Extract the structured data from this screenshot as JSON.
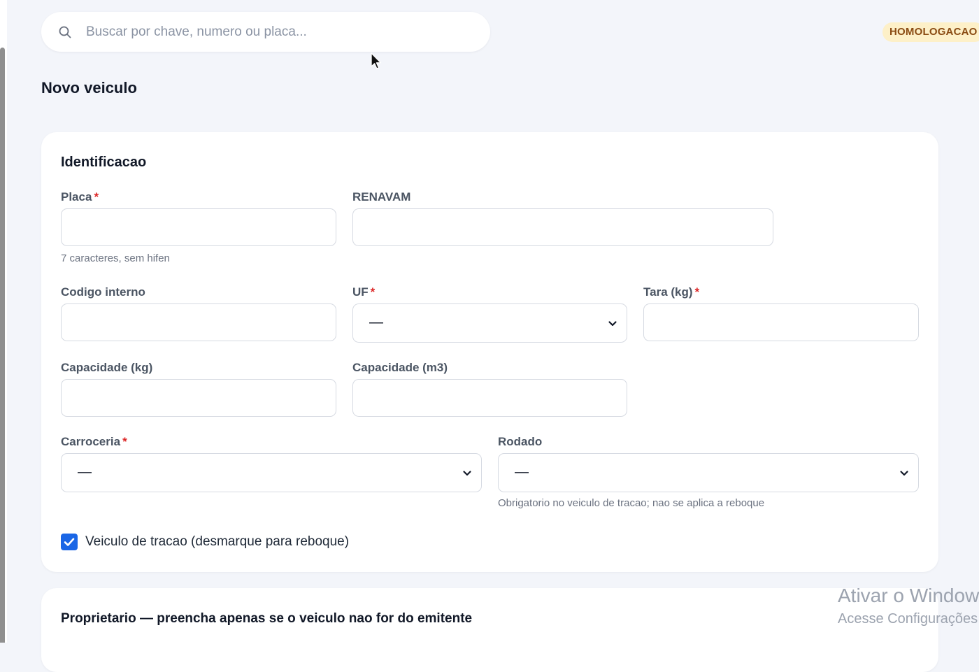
{
  "search": {
    "placeholder": "Buscar por chave, numero ou placa...",
    "value": ""
  },
  "header": {
    "environment_badge": "HOMOLOGACAO"
  },
  "page": {
    "title": "Novo veiculo"
  },
  "identification": {
    "section_title": "Identificacao",
    "placa": {
      "label": "Placa",
      "required_mark": "*",
      "value": "",
      "hint": "7 caracteres, sem hifen"
    },
    "renavam": {
      "label": "RENAVAM",
      "value": ""
    },
    "codigo_interno": {
      "label": "Codigo interno",
      "value": ""
    },
    "uf": {
      "label": "UF",
      "required_mark": "*",
      "selected": "—"
    },
    "tara": {
      "label": "Tara (kg)",
      "required_mark": "*",
      "value": ""
    },
    "capacidade_kg": {
      "label": "Capacidade (kg)",
      "value": ""
    },
    "capacidade_m3": {
      "label": "Capacidade (m3)",
      "value": ""
    },
    "carroceria": {
      "label": "Carroceria",
      "required_mark": "*",
      "selected": "—"
    },
    "rodado": {
      "label": "Rodado",
      "selected": "—",
      "hint": "Obrigatorio no veiculo de tracao; nao se aplica a reboque"
    },
    "traction_checkbox": {
      "label": "Veiculo de tracao (desmarque para reboque)",
      "checked": true
    }
  },
  "owner": {
    "section_title": "Proprietario — preencha apenas se o veiculo nao for do emitente"
  },
  "watermark": {
    "line1": "Ativar o Windows",
    "line2": "Acesse Configurações para ativar o Windows."
  },
  "icons": {
    "search": "search-icon",
    "select": "chevron-down-icon",
    "checkbox": "check-icon",
    "cursor": "mouse-cursor-icon"
  },
  "colors": {
    "accent": "#1a66e6",
    "badge_background": "#fdf0c8",
    "badge_text": "#8a4b12",
    "required": "#dc2626",
    "page_background": "#f3f5fa"
  }
}
